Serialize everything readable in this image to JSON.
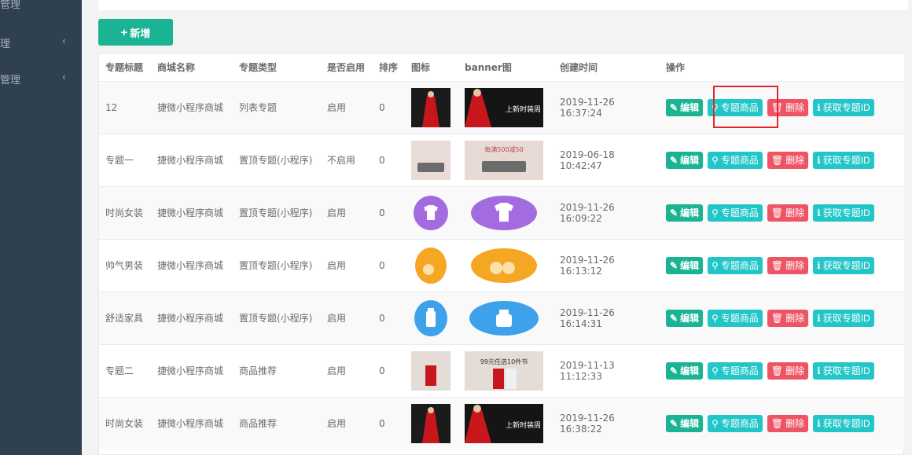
{
  "sidebar": {
    "items": [
      {
        "label": "管理",
        "chevron": false
      },
      {
        "label": "理",
        "chevron": true
      },
      {
        "label": "管理",
        "chevron": true
      }
    ]
  },
  "toolbar": {
    "add_label": "新增"
  },
  "table": {
    "headers": [
      "专题标题",
      "商城名称",
      "专题类型",
      "是否启用",
      "排序",
      "图标",
      "banner图",
      "创建时间",
      "操作"
    ],
    "actions": {
      "edit": "编辑",
      "goods": "专题商品",
      "delete": "删除",
      "get_id": "获取专题ID"
    },
    "rows": [
      {
        "title": "12",
        "mall": "捷微小程序商城",
        "type": "列表专题",
        "enabled": "启用",
        "sort": "0",
        "image": "red-dress",
        "banner_text": "上新时装周",
        "created": "2019-11-26 16:37:24"
      },
      {
        "title": "专题一",
        "mall": "捷微小程序商城",
        "type": "置顶专题(小程序)",
        "enabled": "不启用",
        "sort": "0",
        "image": "sofa",
        "banner_text": "每满500减50",
        "created": "2019-06-18 10:42:47"
      },
      {
        "title": "时尚女装",
        "mall": "捷微小程序商城",
        "type": "置顶专题(小程序)",
        "enabled": "启用",
        "sort": "0",
        "image": "tshirt-purple",
        "banner_text": "",
        "created": "2019-11-26 16:09:22"
      },
      {
        "title": "帅气男装",
        "mall": "捷微小程序商城",
        "type": "置顶专题(小程序)",
        "enabled": "启用",
        "sort": "0",
        "image": "orange-fruit",
        "banner_text": "",
        "created": "2019-11-26 16:13:12"
      },
      {
        "title": "舒适家具",
        "mall": "捷微小程序商城",
        "type": "置顶专题(小程序)",
        "enabled": "启用",
        "sort": "0",
        "image": "bottle-blue",
        "banner_text": "",
        "created": "2019-11-26 16:14:31"
      },
      {
        "title": "专题二",
        "mall": "捷微小程序商城",
        "type": "商品推荐",
        "enabled": "启用",
        "sort": "0",
        "image": "book",
        "banner_text": "99元任选10件书",
        "created": "2019-11-13 11:12:33"
      },
      {
        "title": "时尚女装",
        "mall": "捷微小程序商城",
        "type": "商品推荐",
        "enabled": "启用",
        "sort": "0",
        "image": "red-dress",
        "banner_text": "上新时装周",
        "created": "2019-11-26 16:38:22"
      }
    ]
  },
  "colors": {
    "sidebar": "#2f4050",
    "primary": "#1ab394",
    "info": "#23c6c8",
    "danger": "#ed5565",
    "highlight": "#e0262b"
  }
}
